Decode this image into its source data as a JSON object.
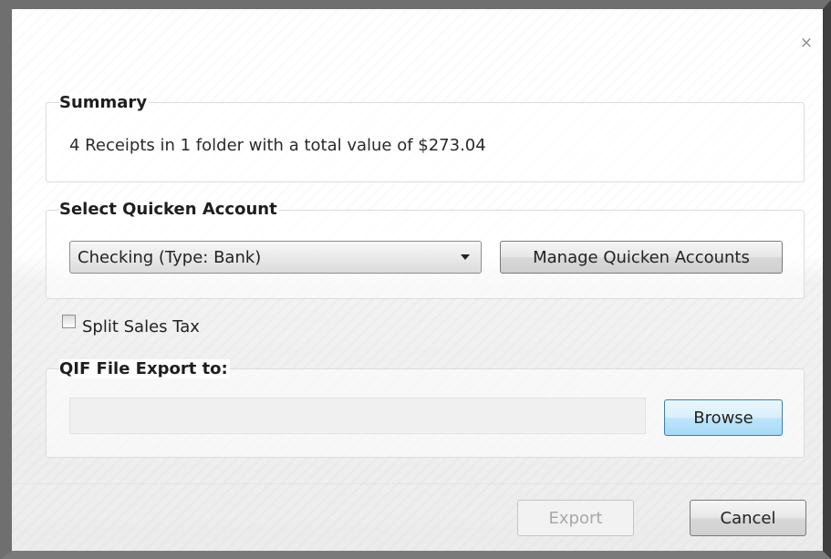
{
  "dialog": {
    "close_glyph": "×"
  },
  "summary": {
    "legend": "Summary",
    "text": "4 Receipts in 1 folder with a total value of $273.04"
  },
  "account": {
    "legend": "Select Quicken Account",
    "selected_value": "Checking (Type: Bank)",
    "manage_label": "Manage Quicken Accounts"
  },
  "split_tax": {
    "label": "Split Sales Tax",
    "checked": false
  },
  "export_path": {
    "legend": "QIF File Export to:",
    "value": "",
    "browse_label": "Browse"
  },
  "footer": {
    "export_label": "Export",
    "export_enabled": false,
    "cancel_label": "Cancel"
  },
  "icons": {
    "close": "close-icon",
    "dropdown": "chevron-down-icon"
  },
  "colors": {
    "browse_focus_border": "#3c7fb1",
    "disabled_text": "#a8a8a8"
  }
}
